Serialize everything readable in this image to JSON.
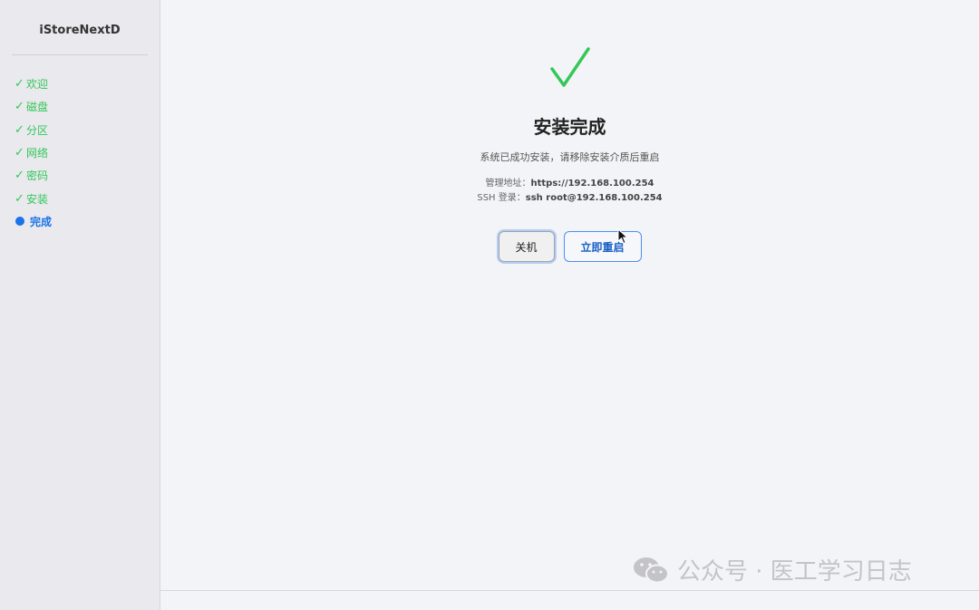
{
  "sidebar": {
    "brand": "iStoreNextD",
    "steps": [
      {
        "label": "欢迎",
        "status": "done"
      },
      {
        "label": "磁盘",
        "status": "done"
      },
      {
        "label": "分区",
        "status": "done"
      },
      {
        "label": "网络",
        "status": "done"
      },
      {
        "label": "密码",
        "status": "done"
      },
      {
        "label": "安装",
        "status": "done"
      },
      {
        "label": "完成",
        "status": "active"
      }
    ],
    "done_mark": "✓"
  },
  "main": {
    "title": "安装完成",
    "subtitle": "系统已成功安装，请移除安装介质后重启",
    "admin_label": "管理地址：",
    "admin_url": "https://192.168.100.254",
    "ssh_label": "SSH 登录：",
    "ssh_cmd": "ssh root@192.168.100.254",
    "shutdown_label": "关机",
    "reboot_label": "立即重启"
  },
  "watermark": {
    "text": "公众号 · 医工学习日志"
  },
  "colors": {
    "success": "#34c759",
    "accent": "#1a73e8"
  }
}
